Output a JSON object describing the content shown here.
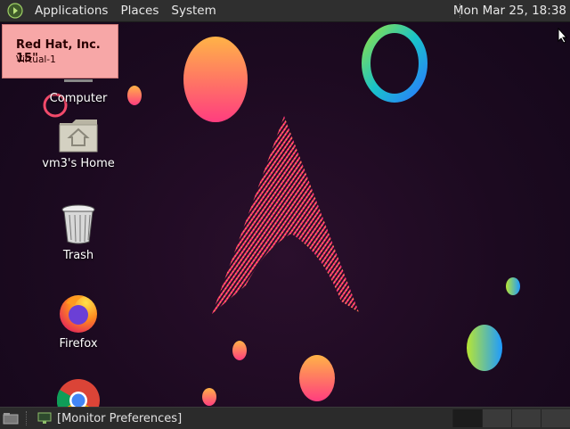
{
  "top_panel": {
    "menus": [
      {
        "label": "Applications"
      },
      {
        "label": "Places"
      },
      {
        "label": "System"
      }
    ],
    "clock": "Mon Mar 25, 18:38"
  },
  "osd": {
    "monitor_name": "Red Hat, Inc. 15\"",
    "connector": "Virtual-1"
  },
  "desktop_icons": [
    {
      "label": "Computer",
      "icon": "computer-icon"
    },
    {
      "label": "vm3's Home",
      "icon": "home-folder-icon"
    },
    {
      "label": "Trash",
      "icon": "trash-icon"
    },
    {
      "label": "Firefox",
      "icon": "firefox-icon"
    },
    {
      "label": "",
      "icon": "chrome-icon"
    }
  ],
  "bottom_panel": {
    "task": "[Monitor Preferences]",
    "workspaces": 4,
    "active_workspace": 1
  },
  "colors": {
    "panel": "#2f2f2f",
    "osd_background": "#f7a7a7",
    "desktop_background": "#1c0a20"
  }
}
